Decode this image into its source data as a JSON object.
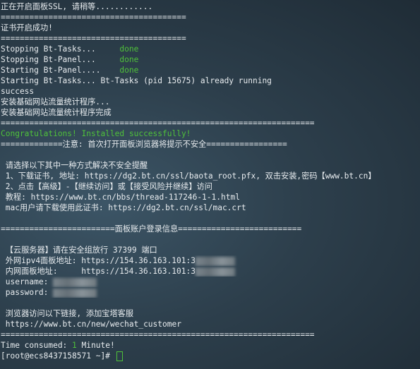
{
  "terminal": {
    "lines": [
      "正在开启面板SSL, 请稍等............",
      "=======================================",
      "证书开启成功!",
      "=======================================",
      "Stopping Bt-Tasks...",
      "Stopping Bt-Panel...",
      "Starting Bt-Panel....",
      "Starting Bt-Tasks... Bt-Tasks (pid 15675) already running",
      "success",
      "安装基础网站流量统计程序...",
      "安装基础网站流量统计程序完成",
      "==================================================================",
      "Congratulations! Installed successfully!",
      "=============注意: 首次打开面板浏览器将提示不安全=================",
      "",
      " 请选择以下其中一种方式解决不安全提醒",
      " 1、下载证书, 地址: https://dg2.bt.cn/ssl/baota_root.pfx, 双击安装,密码【www.bt.cn】",
      " 2、点击【高级】-【继续访问】或【接受风险并继续】访问",
      " 教程: https://www.bt.cn/bbs/thread-117246-1-1.html",
      " mac用户请下载使用此证书: https://dg2.bt.cn/ssl/mac.crt",
      "",
      "========================面板账户登录信息==========================",
      "",
      " 【云服务器】请在安全组放行 37399 端口",
      " 外网ipv4面板地址: https://154.36.163.101:3",
      " 内网面板地址:     https://154.36.163.101:3",
      " username: ",
      " password: ",
      "",
      " 浏览器访问以下链接, 添加宝塔客服",
      " https://www.bt.cn/new/wechat_customer",
      "==================================================================",
      "Time consumed: ",
      "[root@ecs8437158571 ~]# "
    ],
    "status_done": "done",
    "time_value": "1",
    "time_unit": " Minute!"
  },
  "colors": {
    "background": "#2b3b48",
    "text": "#e8ecef",
    "success_green": "#4fc13a"
  }
}
